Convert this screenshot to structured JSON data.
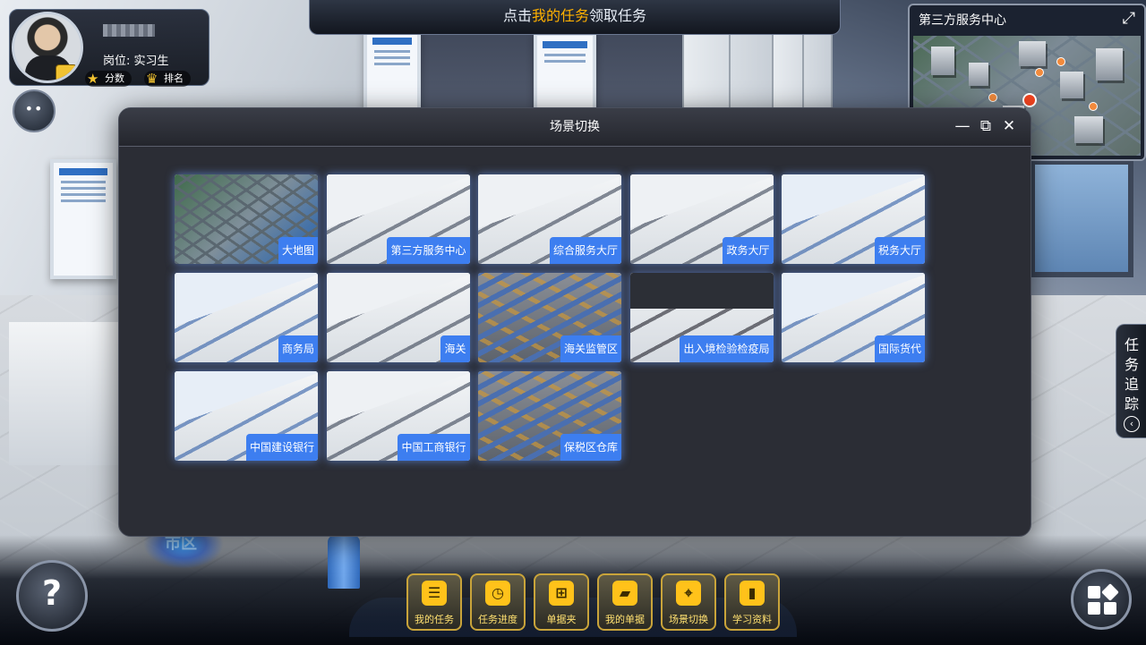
{
  "user": {
    "position_label": "岗位: 实习生",
    "score_label": "分数",
    "rank_label": "排名"
  },
  "notice": {
    "prefix": "点击",
    "highlight": "我的任务",
    "suffix": "领取任务"
  },
  "minimap": {
    "title": "第三方服务中心",
    "expand_icon": "expand-icon"
  },
  "modal": {
    "title": "场景切换",
    "scenes": [
      {
        "label": "大地图",
        "style": "city"
      },
      {
        "label": "第三方服务中心",
        "style": "room"
      },
      {
        "label": "综合服务大厅",
        "style": "room"
      },
      {
        "label": "政务大厅",
        "style": "room"
      },
      {
        "label": "税务大厅",
        "style": "blue"
      },
      {
        "label": "商务局",
        "style": "blue"
      },
      {
        "label": "海关",
        "style": "room"
      },
      {
        "label": "海关监管区",
        "style": "warehouse"
      },
      {
        "label": "出入境检验检疫局",
        "style": "dark"
      },
      {
        "label": "国际货代",
        "style": "blue"
      },
      {
        "label": "中国建设银行",
        "style": "blue"
      },
      {
        "label": "中国工商银行",
        "style": "room"
      },
      {
        "label": "保税区仓库",
        "style": "warehouse"
      }
    ]
  },
  "side_tab": {
    "label": "任务追踪"
  },
  "toolbar": {
    "buttons": [
      {
        "label": "我的任务",
        "icon": "list-icon"
      },
      {
        "label": "任务进度",
        "icon": "clock-icon"
      },
      {
        "label": "单据夹",
        "icon": "folder-add-icon"
      },
      {
        "label": "我的单据",
        "icon": "folder-icon"
      },
      {
        "label": "场景切换",
        "icon": "map-pin-icon"
      },
      {
        "label": "学习资料",
        "icon": "book-icon"
      }
    ]
  },
  "scene_bg": {
    "floor_sign": "市区"
  },
  "colors": {
    "accent": "#3d7ef0",
    "highlight": "#ffb000",
    "toolbar_label": "#ffe070"
  }
}
